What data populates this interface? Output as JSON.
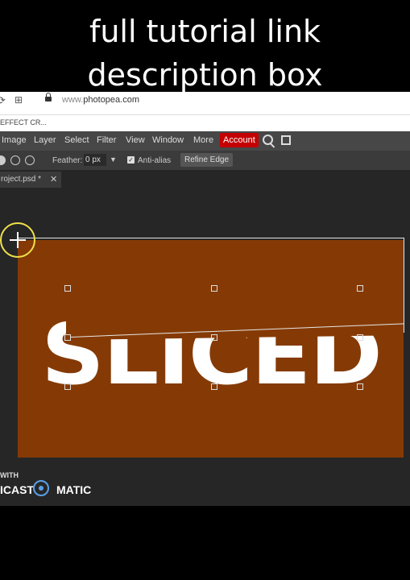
{
  "caption": {
    "line1": "full tutorial link",
    "line2": "description box"
  },
  "browser": {
    "url_prefix": "www.",
    "url_domain": "photopea.com",
    "tab_label": "EFFECT CR..."
  },
  "menubar": {
    "items": [
      "Image",
      "Layer",
      "Select",
      "Filter",
      "View",
      "Window",
      "More"
    ],
    "account_label": "Account",
    "account_color": "#c40000"
  },
  "tool_options": {
    "feather_label": "Feather:",
    "feather_value": "0 px",
    "antialias_label": "Anti-alias",
    "antialias_checked": true,
    "refine_label": "Refine Edge"
  },
  "document": {
    "tab_label": "roject.psd *",
    "close_glyph": "✕",
    "canvas_color": "#853a05",
    "canvas_text": "SLICED"
  },
  "watermark": {
    "with": "WITH",
    "brand_left": "ICAST",
    "brand_right": "MATIC",
    "logo_color": "#5aa0e8"
  }
}
